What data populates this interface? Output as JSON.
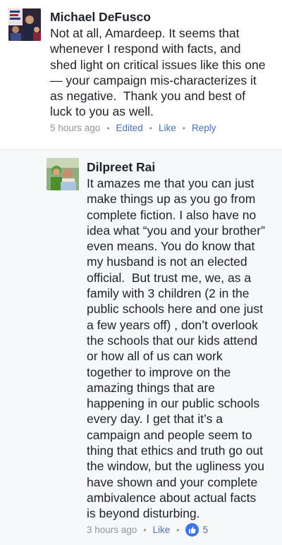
{
  "comments": [
    {
      "author": "Michael DeFusco",
      "text": "Not at all, Amardeep. It seems that\nwhenever I respond with facts, and\nshed light on critical issues like this one\n— your campaign mis-characterizes it\nas negative.  Thank you and best of\nluck to you as well.",
      "time": "5 hours ago",
      "edited_label": "Edited",
      "like_label": "Like",
      "reply_label": "Reply",
      "avatar_icon": "profile-photo-icon"
    },
    {
      "author": "Dilpreet Rai",
      "text": "It amazes me that you can just\nmake things up as you go from\ncomplete fiction. I also have no\nidea what “you and your brother”\neven means. You do know that\nmy husband is not an elected\nofficial.  But trust me, we, as a\nfamily with 3 children (2 in the\npublic schools here and one just\na few years off) , don’t overlook\nthe schools that our kids attend\nor how all of us can work\ntogether to improve on the\namazing things that are\nhappening in our public schools\nevery day. I get that it’s a\ncampaign and people seem to\nthing that ethics and truth go out\nthe window, but the ugliness you\nhave shown and your complete\nambivalence about actual facts\nis beyond disturbing.",
      "time": "3 hours ago",
      "like_label": "Like",
      "reaction_count": "5",
      "reaction_icon": "thumbs-up-icon",
      "avatar_icon": "profile-photo-icon"
    }
  ],
  "colors": {
    "link": "#4b6fb3",
    "meta": "#90949c",
    "like_badge": "#3b73e8"
  }
}
